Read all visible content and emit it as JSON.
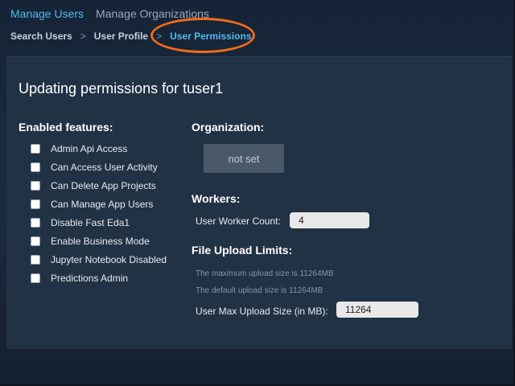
{
  "topnav": {
    "tabs": [
      {
        "label": "Manage Users",
        "active": true
      },
      {
        "label": "Manage Organizations",
        "active": false
      }
    ]
  },
  "breadcrumb": {
    "items": [
      "Search Users",
      "User Profile",
      "User Permissions"
    ],
    "separator": ">"
  },
  "page": {
    "title": "Updating permissions for tuser1"
  },
  "features": {
    "heading": "Enabled features:",
    "items": [
      {
        "label": "Admin Api Access",
        "checked": false
      },
      {
        "label": "Can Access User Activity",
        "checked": false
      },
      {
        "label": "Can Delete App Projects",
        "checked": false
      },
      {
        "label": "Can Manage App Users",
        "checked": false
      },
      {
        "label": "Disable Fast Eda1",
        "checked": false
      },
      {
        "label": "Enable Business Mode",
        "checked": false
      },
      {
        "label": "Jupyter Notebook Disabled",
        "checked": false
      },
      {
        "label": "Predictions Admin",
        "checked": false
      }
    ]
  },
  "organization": {
    "heading": "Organization:",
    "button_label": "not set"
  },
  "workers": {
    "heading": "Workers:",
    "count_label": "User Worker Count:",
    "count_value": "4"
  },
  "upload": {
    "heading": "File Upload Limits:",
    "max_note": "The maximum upload size is 11264MB",
    "default_note": "The default upload size is 11264MB",
    "size_label": "User Max Upload Size (in MB):",
    "size_value": "11264"
  },
  "colors": {
    "accent": "#55b9ef",
    "highlight_ring": "#f26a1b",
    "panel": "#223245"
  }
}
